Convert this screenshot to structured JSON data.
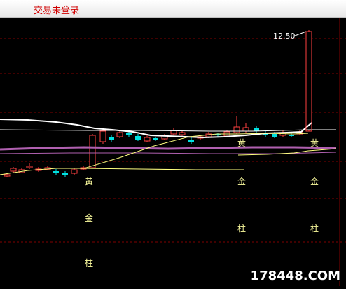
{
  "header": {
    "login_status": "交易未登录"
  },
  "chart_data": {
    "type": "candlestick",
    "price_label": "12.50",
    "signals": [
      {
        "text": "黄"
      },
      {
        "text": "金"
      },
      {
        "text": "柱"
      },
      {
        "text": "黄"
      },
      {
        "text": "金"
      },
      {
        "text": "柱"
      },
      {
        "text": "黄"
      },
      {
        "text": "金"
      },
      {
        "text": "柱"
      }
    ],
    "colors": {
      "up": "#ff4040",
      "down": "#00e0e0",
      "neutral": "#ffffff",
      "grid": "#800000",
      "ma_white": "#ffffff",
      "ma_purple": "#b060b0",
      "ma_yellow": "#ffff80",
      "signal_text": "#ffffa0"
    }
  },
  "watermark": "178448.COM"
}
